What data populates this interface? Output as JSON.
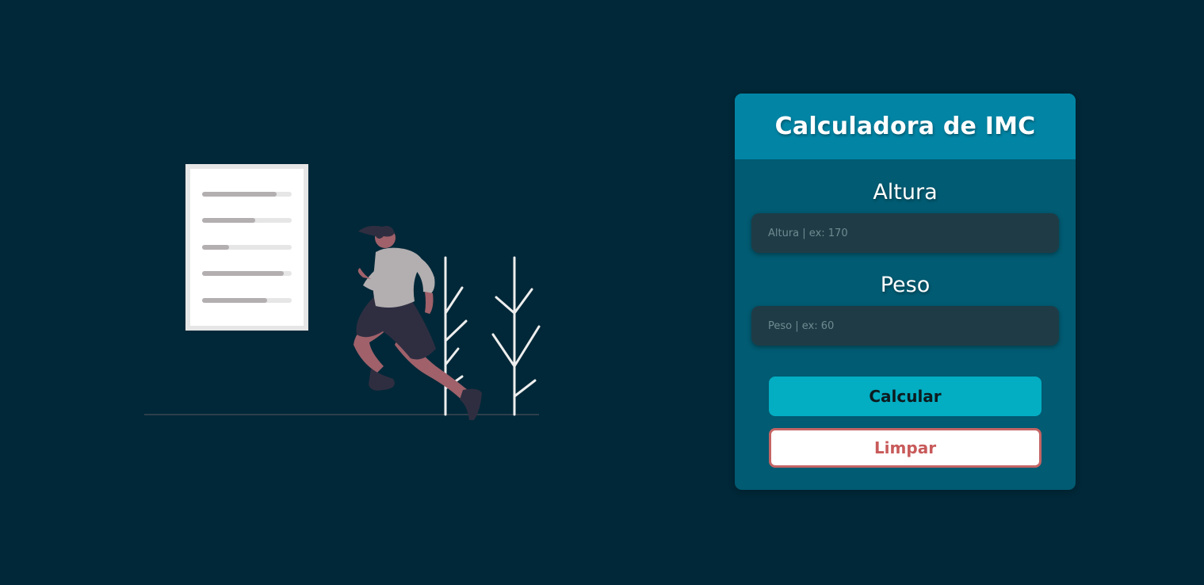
{
  "card": {
    "title": "Calculadora de IMC",
    "height_label": "Altura",
    "height_placeholder": "Altura | ex: 170",
    "weight_label": "Peso",
    "weight_placeholder": "Peso | ex: 60",
    "calc_button": "Calcular",
    "clear_button": "Limpar"
  },
  "colors": {
    "background": "#012838",
    "card": "#015b72",
    "card_header": "#0285a5",
    "input": "#1f3c46",
    "calc_button": "#03adc2",
    "clear_button_text": "#c85a5a"
  },
  "illustration": {
    "description_icon": "runner-illustration"
  }
}
